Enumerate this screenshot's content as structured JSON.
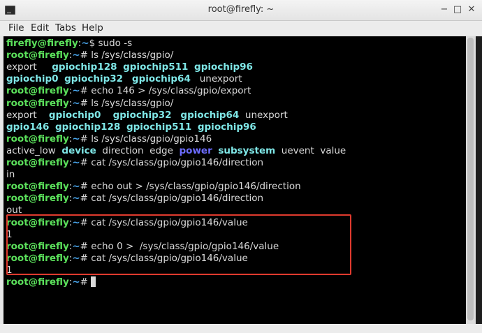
{
  "window": {
    "title": "root@firefly: ~",
    "minimize_glyph": "−",
    "maximize_glyph": "□",
    "close_glyph": "✕"
  },
  "menu": [
    "File",
    "Edit",
    "Tabs",
    "Help"
  ],
  "colors": {
    "prompt": "#5be05b",
    "path": "#4aa8f0",
    "dir": "#7fe7e7",
    "bluedir": "#6c6cff",
    "highlight": "#e03a2e"
  },
  "terminal": {
    "lines": [
      [
        {
          "t": "firefly@firefly",
          "c": "prompt"
        },
        {
          "t": ":",
          "c": "sep"
        },
        {
          "t": "~",
          "c": "path"
        },
        {
          "t": "$ sudo -s",
          "c": "plain"
        }
      ],
      [
        {
          "t": "root@firefly",
          "c": "prompt"
        },
        {
          "t": ":",
          "c": "sep"
        },
        {
          "t": "~",
          "c": "path"
        },
        {
          "t": "# ls /sys/class/gpio/",
          "c": "plain"
        }
      ],
      [
        {
          "t": "export     ",
          "c": "plain"
        },
        {
          "t": "gpiochip128",
          "c": "dir"
        },
        {
          "t": "  ",
          "c": "plain"
        },
        {
          "t": "gpiochip511",
          "c": "dir"
        },
        {
          "t": "  ",
          "c": "plain"
        },
        {
          "t": "gpiochip96",
          "c": "dir"
        }
      ],
      [
        {
          "t": "gpiochip0",
          "c": "dir"
        },
        {
          "t": "  ",
          "c": "plain"
        },
        {
          "t": "gpiochip32",
          "c": "dir"
        },
        {
          "t": "   ",
          "c": "plain"
        },
        {
          "t": "gpiochip64",
          "c": "dir"
        },
        {
          "t": "   unexport",
          "c": "plain"
        }
      ],
      [
        {
          "t": "root@firefly",
          "c": "prompt"
        },
        {
          "t": ":",
          "c": "sep"
        },
        {
          "t": "~",
          "c": "path"
        },
        {
          "t": "# echo 146 > /sys/class/gpio/export",
          "c": "plain"
        }
      ],
      [
        {
          "t": "root@firefly",
          "c": "prompt"
        },
        {
          "t": ":",
          "c": "sep"
        },
        {
          "t": "~",
          "c": "path"
        },
        {
          "t": "# ls /sys/class/gpio/",
          "c": "plain"
        }
      ],
      [
        {
          "t": "export    ",
          "c": "plain"
        },
        {
          "t": "gpiochip0",
          "c": "dir"
        },
        {
          "t": "    ",
          "c": "plain"
        },
        {
          "t": "gpiochip32",
          "c": "dir"
        },
        {
          "t": "   ",
          "c": "plain"
        },
        {
          "t": "gpiochip64",
          "c": "dir"
        },
        {
          "t": "  unexport",
          "c": "plain"
        }
      ],
      [
        {
          "t": "gpio146",
          "c": "dir"
        },
        {
          "t": "  ",
          "c": "plain"
        },
        {
          "t": "gpiochip128",
          "c": "dir"
        },
        {
          "t": "  ",
          "c": "plain"
        },
        {
          "t": "gpiochip511",
          "c": "dir"
        },
        {
          "t": "  ",
          "c": "plain"
        },
        {
          "t": "gpiochip96",
          "c": "dir"
        }
      ],
      [
        {
          "t": "root@firefly",
          "c": "prompt"
        },
        {
          "t": ":",
          "c": "sep"
        },
        {
          "t": "~",
          "c": "path"
        },
        {
          "t": "# ls /sys/class/gpio/gpio146",
          "c": "plain"
        }
      ],
      [
        {
          "t": "active_low  ",
          "c": "plain"
        },
        {
          "t": "device",
          "c": "dir"
        },
        {
          "t": "  direction  edge  ",
          "c": "plain"
        },
        {
          "t": "power",
          "c": "bluedir"
        },
        {
          "t": "  ",
          "c": "plain"
        },
        {
          "t": "subsystem",
          "c": "dir"
        },
        {
          "t": "  uevent  value",
          "c": "plain"
        }
      ],
      [
        {
          "t": "root@firefly",
          "c": "prompt"
        },
        {
          "t": ":",
          "c": "sep"
        },
        {
          "t": "~",
          "c": "path"
        },
        {
          "t": "# cat /sys/class/gpio/gpio146/direction",
          "c": "plain"
        }
      ],
      [
        {
          "t": "in",
          "c": "plain"
        }
      ],
      [
        {
          "t": "root@firefly",
          "c": "prompt"
        },
        {
          "t": ":",
          "c": "sep"
        },
        {
          "t": "~",
          "c": "path"
        },
        {
          "t": "# echo out > /sys/class/gpio/gpio146/direction",
          "c": "plain"
        }
      ],
      [
        {
          "t": "root@firefly",
          "c": "prompt"
        },
        {
          "t": ":",
          "c": "sep"
        },
        {
          "t": "~",
          "c": "path"
        },
        {
          "t": "# cat /sys/class/gpio/gpio146/direction",
          "c": "plain"
        }
      ],
      [
        {
          "t": "out",
          "c": "plain"
        }
      ],
      [
        {
          "t": "root@firefly",
          "c": "prompt"
        },
        {
          "t": ":",
          "c": "sep"
        },
        {
          "t": "~",
          "c": "path"
        },
        {
          "t": "# cat /sys/class/gpio/gpio146/value",
          "c": "plain"
        }
      ],
      [
        {
          "t": "1",
          "c": "plain"
        }
      ],
      [
        {
          "t": "root@firefly",
          "c": "prompt"
        },
        {
          "t": ":",
          "c": "sep"
        },
        {
          "t": "~",
          "c": "path"
        },
        {
          "t": "# echo 0 >  /sys/class/gpio/gpio146/value",
          "c": "plain"
        }
      ],
      [
        {
          "t": "root@firefly",
          "c": "prompt"
        },
        {
          "t": ":",
          "c": "sep"
        },
        {
          "t": "~",
          "c": "path"
        },
        {
          "t": "# cat /sys/class/gpio/gpio146/value",
          "c": "plain"
        }
      ],
      [
        {
          "t": "1",
          "c": "plain"
        }
      ],
      [
        {
          "t": "root@firefly",
          "c": "prompt"
        },
        {
          "t": ":",
          "c": "sep"
        },
        {
          "t": "~",
          "c": "path"
        },
        {
          "t": "# ",
          "c": "plain"
        }
      ]
    ]
  }
}
